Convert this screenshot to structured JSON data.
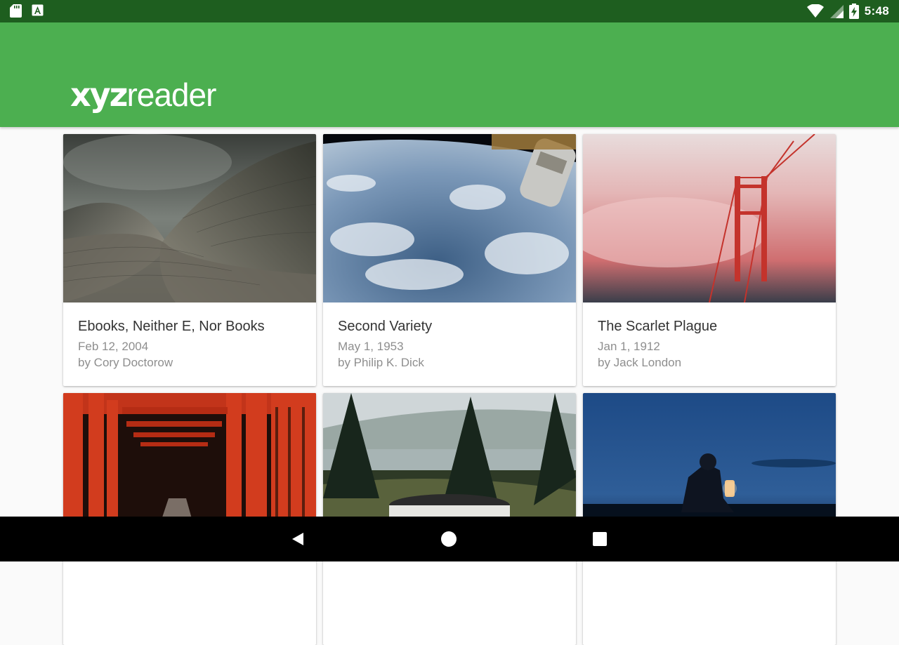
{
  "status_bar": {
    "time": "5:48",
    "icons": [
      "sd-card-icon",
      "a-notification-icon",
      "wifi-icon",
      "signal-icon",
      "battery-charging-icon"
    ]
  },
  "app": {
    "logo_bold": "xyz",
    "logo_light": "reader",
    "brand_color": "#4caf50",
    "status_color": "#1e5e1f"
  },
  "articles": [
    {
      "title": "Ebooks, Neither E, Nor Books",
      "date": "Feb 12, 2004",
      "author": "by Cory Doctorow",
      "image": "opera-house-roof"
    },
    {
      "title": "Second Variety",
      "date": "May 1, 1953",
      "author": "by Philip K. Dick",
      "image": "earth-from-space-station"
    },
    {
      "title": "The Scarlet Plague",
      "date": "Jan 1, 1912",
      "author": "by Jack London",
      "image": "golden-gate-bridge-fog"
    },
    {
      "title": "",
      "date": "",
      "author": "",
      "image": "torii-gates"
    },
    {
      "title": "",
      "date": "",
      "author": "",
      "image": "lake-forest-mug"
    },
    {
      "title": "",
      "date": "",
      "author": "",
      "image": "night-lantern"
    }
  ],
  "nav_bar": {
    "icons": [
      "back-icon",
      "home-icon",
      "recents-icon"
    ]
  }
}
